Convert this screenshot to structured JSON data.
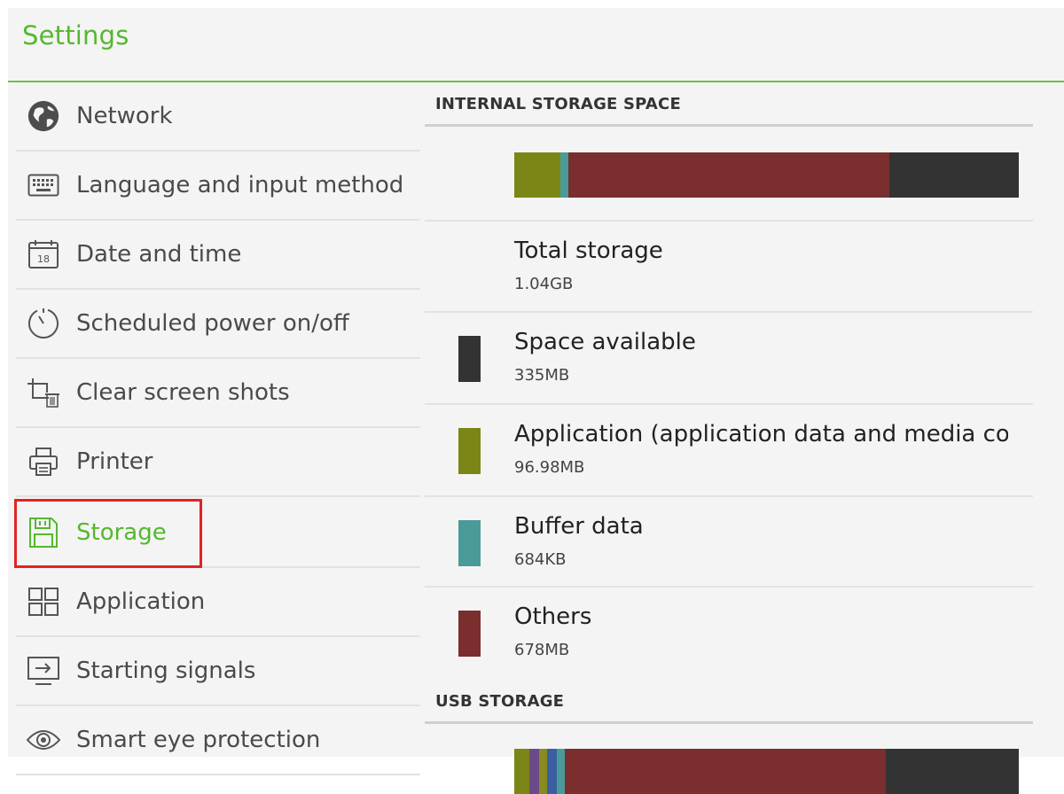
{
  "header": {
    "title": "Settings"
  },
  "sidebar": {
    "items": [
      {
        "label": "Network",
        "icon": "globe-icon"
      },
      {
        "label": "Language and input method",
        "icon": "keyboard-icon"
      },
      {
        "label": "Date and time",
        "icon": "calendar-icon",
        "icon_text": "18"
      },
      {
        "label": "Scheduled power on/off",
        "icon": "timer-icon"
      },
      {
        "label": "Clear screen shots",
        "icon": "crop-trash-icon"
      },
      {
        "label": "Printer",
        "icon": "printer-icon"
      },
      {
        "label": "Storage",
        "icon": "floppy-disk-icon",
        "selected": true
      },
      {
        "label": "Application",
        "icon": "grid-apps-icon"
      },
      {
        "label": "Starting signals",
        "icon": "input-signal-icon"
      },
      {
        "label": "Smart eye protection",
        "icon": "eye-icon"
      }
    ]
  },
  "internal": {
    "section_title": "INTERNAL STORAGE SPACE",
    "usage_bar_percent": [
      {
        "name": "application",
        "percent": 9.1,
        "color": "#7b8616"
      },
      {
        "name": "buffer",
        "percent": 1.6,
        "color": "#4a9a9a"
      },
      {
        "name": "others",
        "percent": 63.6,
        "color": "#7a2e2e"
      },
      {
        "name": "available",
        "percent": 25.7,
        "color": "#333333"
      }
    ],
    "total": {
      "title": "Total storage",
      "value": "1.04GB"
    },
    "rows": [
      {
        "title": "Space available",
        "value": "335MB",
        "color": "#333333"
      },
      {
        "title": "Application (application data and media content)",
        "value": "96.98MB",
        "color": "#7b8616"
      },
      {
        "title": "Buffer data",
        "value": "684KB",
        "color": "#4a9a9a"
      },
      {
        "title": "Others",
        "value": "678MB",
        "color": "#7a2e2e"
      }
    ]
  },
  "usb": {
    "section_title": "USB STORAGE",
    "usage_bar_percent": [
      {
        "name": "application",
        "percent": 3.0,
        "color": "#7b8616"
      },
      {
        "name": "segment-purple",
        "percent": 2.0,
        "color": "#6b4a8a"
      },
      {
        "name": "segment-olive",
        "percent": 1.5,
        "color": "#8a8a22"
      },
      {
        "name": "segment-blue",
        "percent": 2.0,
        "color": "#3b5fa0"
      },
      {
        "name": "buffer",
        "percent": 1.6,
        "color": "#4a9a9a"
      },
      {
        "name": "others",
        "percent": 63.6,
        "color": "#7a2e2e"
      },
      {
        "name": "available",
        "percent": 26.3,
        "color": "#333333"
      }
    ]
  },
  "colors": {
    "accent": "#55b82e",
    "highlight_box": "#e02424"
  }
}
